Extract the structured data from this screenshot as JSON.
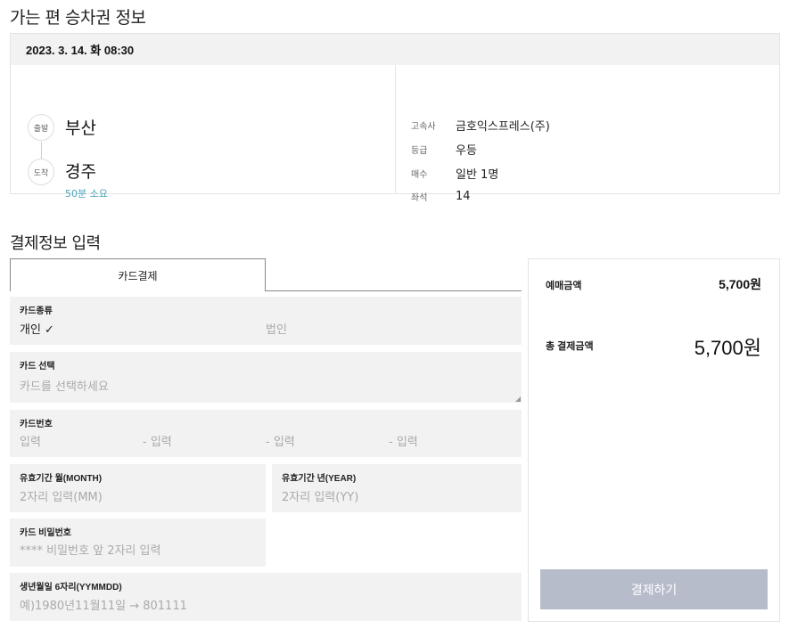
{
  "section_title": "가는 편 승차권 정보",
  "ticket": {
    "datetime": "2023. 3. 14. 화 08:30",
    "departure_badge": "출발",
    "departure": "부산",
    "arrival_badge": "도착",
    "arrival": "경주",
    "duration": "50분 소요",
    "info": [
      {
        "label": "고속사",
        "value": "금호익스프레스(주)"
      },
      {
        "label": "등급",
        "value": "우등"
      },
      {
        "label": "매수",
        "value": "일반 1명"
      },
      {
        "label": "좌석",
        "value": "14"
      }
    ]
  },
  "payment": {
    "title": "결제정보 입력",
    "tab_label": "카드결제",
    "card_type": {
      "label": "카드종류",
      "option_personal": "개인 ✓",
      "option_corporate": "법인"
    },
    "card_select": {
      "label": "카드 선택",
      "placeholder": "카드를 선택하세요"
    },
    "card_number": {
      "label": "카드번호",
      "parts": [
        "입력",
        "- 입력",
        "- 입력",
        "- 입력"
      ]
    },
    "expiry_month": {
      "label": "유효기간 월(MONTH)",
      "placeholder": "2자리 입력(MM)"
    },
    "expiry_year": {
      "label": "유효기간 년(YEAR)",
      "placeholder": "2자리 입력(YY)"
    },
    "password": {
      "label": "카드 비밀번호",
      "placeholder": "**** 비밀번호 앞 2자리 입력"
    },
    "birth": {
      "label": "생년월일 6자리(YYMMDD)",
      "placeholder": "예)1980년11월11일 → 801111"
    }
  },
  "summary": {
    "sale_label": "예매금액",
    "sale_amount": "5,700원",
    "total_label": "총 결제금액",
    "total_amount": "5,700원",
    "pay_button": "결제하기"
  }
}
